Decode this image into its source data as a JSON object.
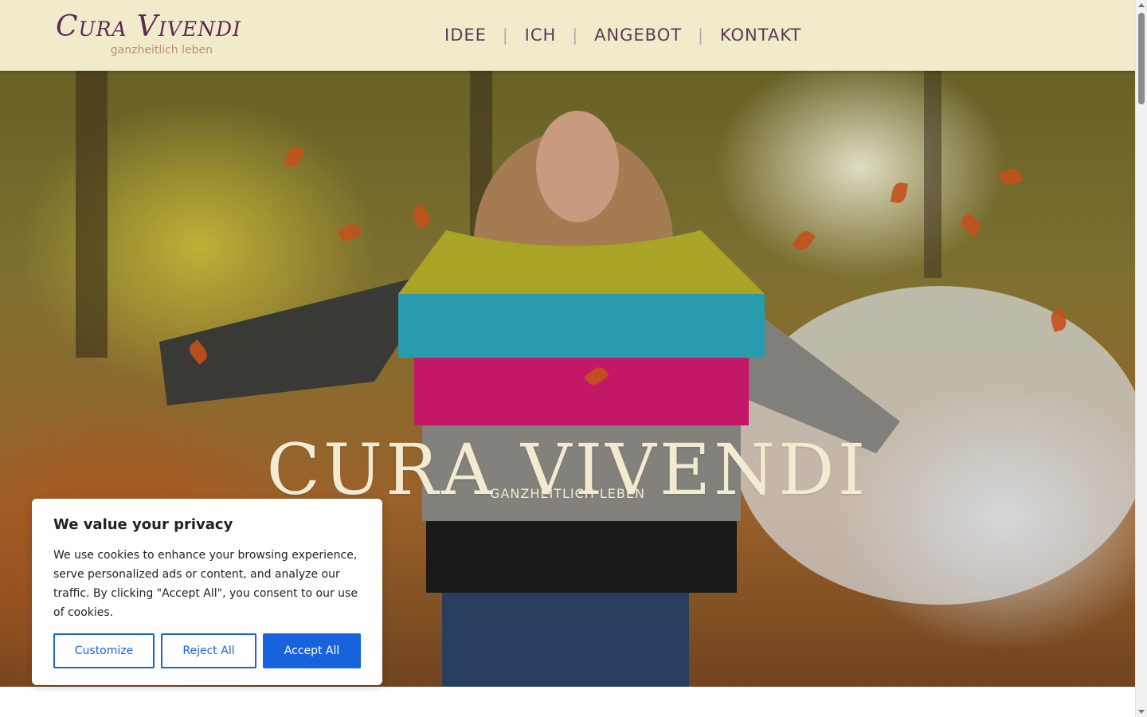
{
  "brand": {
    "title": "Cura Vivendi",
    "tagline": "ganzheitlich leben"
  },
  "nav": {
    "items": [
      {
        "label": "IDEE"
      },
      {
        "label": "ICH"
      },
      {
        "label": "ANGEBOT"
      },
      {
        "label": "KONTAKT"
      }
    ],
    "separator": "|"
  },
  "hero": {
    "title": "CURA VIVENDI",
    "subtitle": "GANZHEITLICH LEBEN"
  },
  "cookie_banner": {
    "title": "We value your privacy",
    "text": "We use cookies to enhance your browsing experience, serve personalized ads or content, and analyze our traffic. By clicking \"Accept All\", you consent to our use of cookies.",
    "customize_label": "Customize",
    "reject_label": "Reject All",
    "accept_label": "Accept All",
    "accent_color": "#1863dc"
  },
  "colors": {
    "header_bg": "#f1eacb",
    "brand_purple": "#5b2a55",
    "hero_text": "#f3ead2"
  }
}
